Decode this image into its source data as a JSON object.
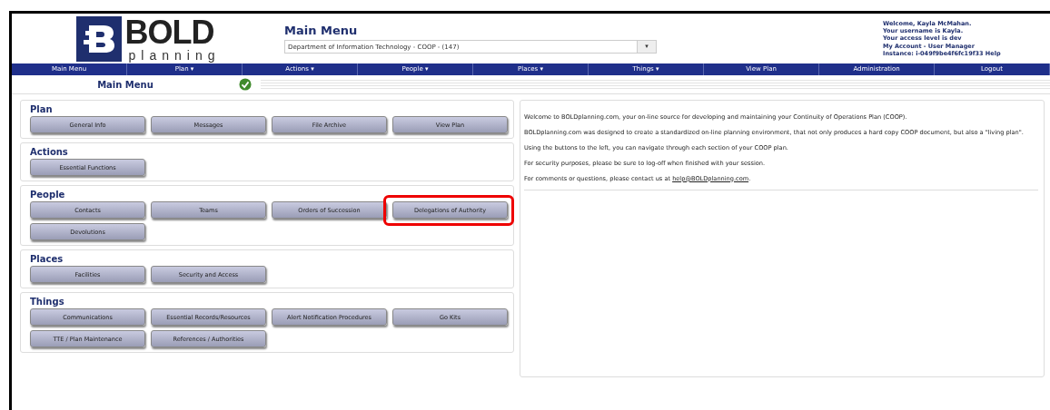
{
  "logo": {
    "word": "BOLD",
    "tagline": "planning"
  },
  "header": {
    "title": "Main Menu",
    "department": "Department of Information Technology - COOP - (147)",
    "dropdown_arrow": "▾"
  },
  "user_info": [
    "Welcome, Kayla McMahan.",
    "Your username is Kayla.",
    "Your access level is dev",
    "My Account - User Manager",
    "Instance: i-049f9be4f6fc19f33 Help"
  ],
  "nav": [
    "Main Menu",
    "Plan ▾",
    "Actions ▾",
    "People ▾",
    "Places ▾",
    "Things ▾",
    "View Plan",
    "Administration",
    "Logout"
  ],
  "subheader": {
    "title": "Main Menu",
    "ok": true
  },
  "sections": [
    {
      "title": "Plan",
      "buttons": [
        {
          "label": "General Info",
          "highlighted": false
        },
        {
          "label": "Messages",
          "highlighted": false
        },
        {
          "label": "File Archive",
          "highlighted": false
        },
        {
          "label": "View Plan",
          "highlighted": false
        }
      ]
    },
    {
      "title": "Actions",
      "buttons": [
        {
          "label": "Essential Functions",
          "highlighted": false
        }
      ]
    },
    {
      "title": "People",
      "buttons": [
        {
          "label": "Contacts",
          "highlighted": false
        },
        {
          "label": "Teams",
          "highlighted": false
        },
        {
          "label": "Orders of Succession",
          "highlighted": false
        },
        {
          "label": "Delegations of Authority",
          "highlighted": true
        },
        {
          "label": "Devolutions",
          "highlighted": false
        }
      ]
    },
    {
      "title": "Places",
      "buttons": [
        {
          "label": "Facilities",
          "highlighted": false
        },
        {
          "label": "Security and Access",
          "highlighted": false
        }
      ]
    },
    {
      "title": "Things",
      "buttons": [
        {
          "label": "Communications",
          "highlighted": false
        },
        {
          "label": "Essential Records/Resources",
          "highlighted": false
        },
        {
          "label": "Alert Notification Procedures",
          "highlighted": false
        },
        {
          "label": "Go Kits",
          "highlighted": false
        },
        {
          "label": "TTE / Plan Maintenance",
          "highlighted": false
        },
        {
          "label": "References / Authorities",
          "highlighted": false
        }
      ]
    }
  ],
  "welcome": [
    {
      "kind": "text",
      "text": "Welcome to BOLDplanning.com, your on-line source for developing and maintaining your Continuity of Operations Plan (COOP)."
    },
    {
      "kind": "text",
      "text": "BOLDplanning.com was designed to create a standardized on-line planning environment, that not only produces a hard copy COOP document, but also a \"living plan\"."
    },
    {
      "kind": "text",
      "text": "Using the buttons to the left, you can navigate through each section of your COOP plan."
    },
    {
      "kind": "text",
      "text": "For security purposes, please be sure to log-off when finished with your session."
    },
    {
      "kind": "contact",
      "before": "For comments or questions, please contact us at ",
      "link": "help@BOLDplanning.com",
      "after": "."
    }
  ]
}
